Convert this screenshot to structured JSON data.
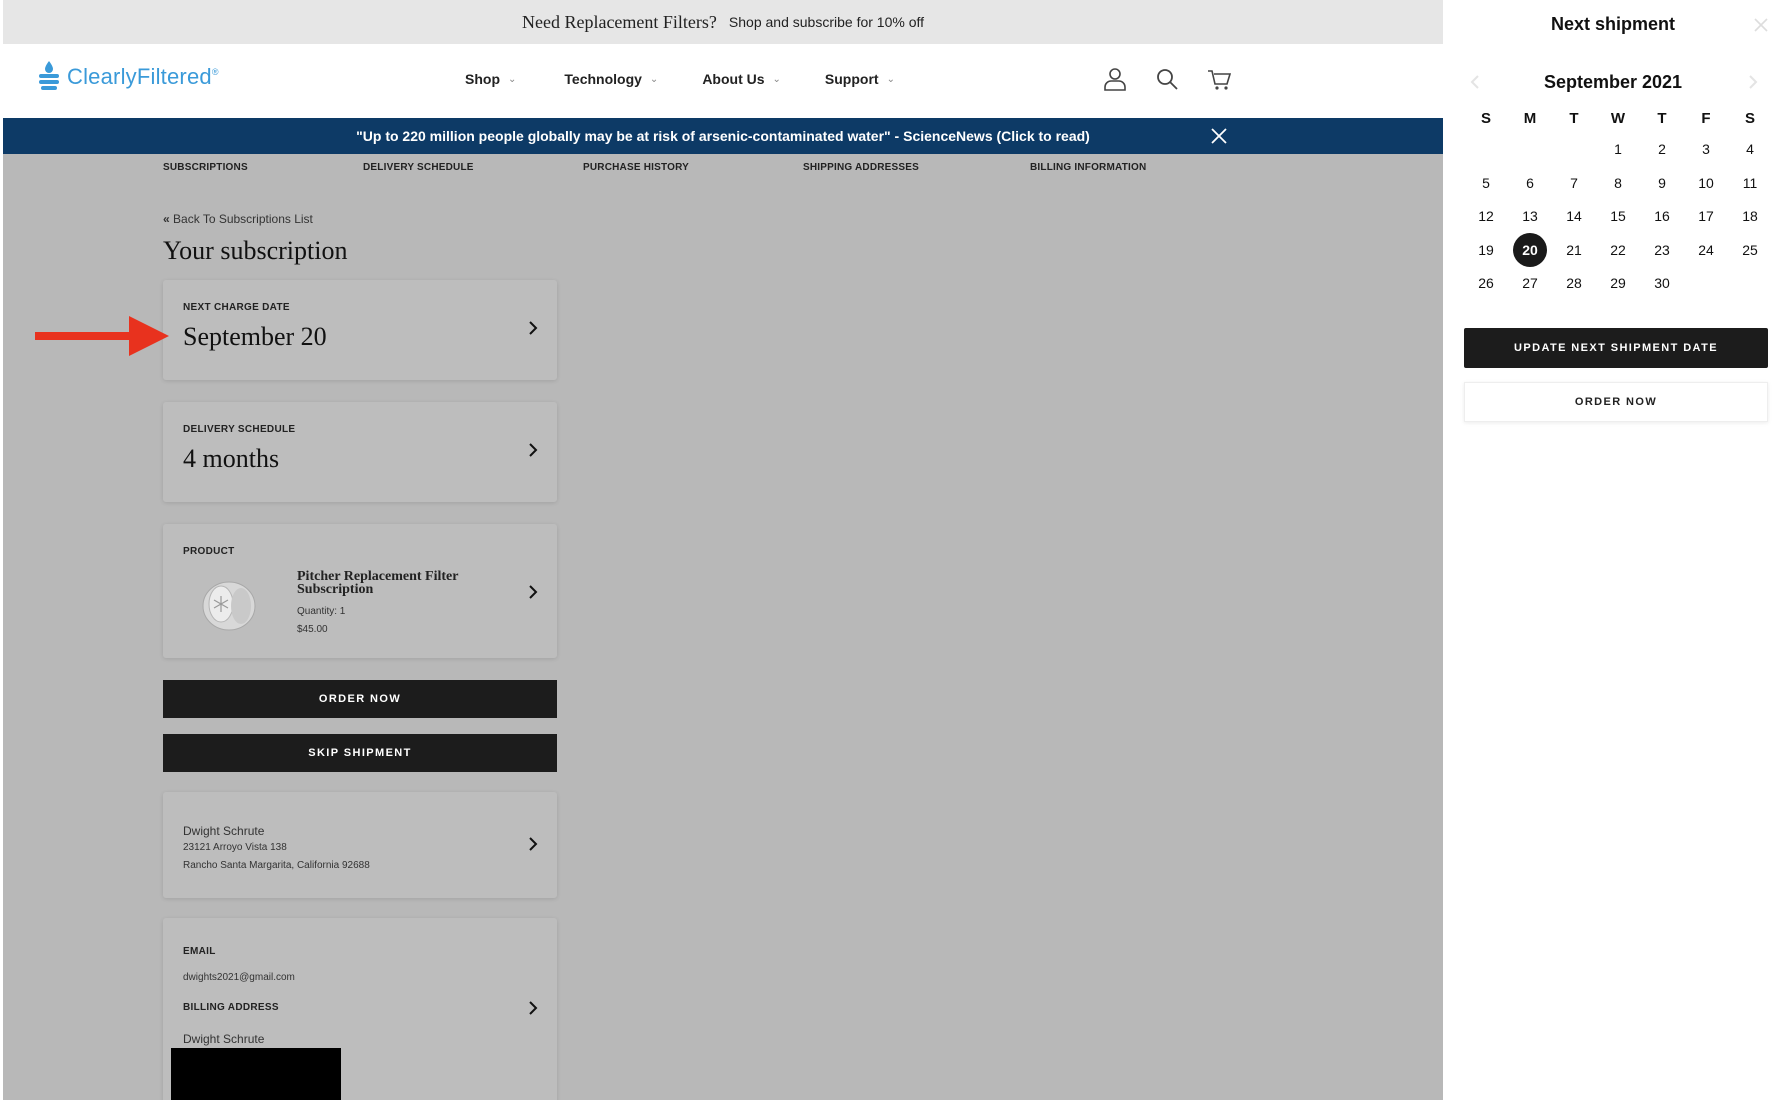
{
  "promo": {
    "headline": "Need Replacement Filters?",
    "offer": "Shop and subscribe for 10% off"
  },
  "header": {
    "brand": "ClearlyFiltered",
    "brand_mark": "®",
    "nav": [
      {
        "label": "Shop"
      },
      {
        "label": "Technology"
      },
      {
        "label": "About Us"
      },
      {
        "label": "Support"
      }
    ],
    "icons": [
      "account-icon",
      "search-icon",
      "cart-icon"
    ]
  },
  "alert": {
    "text": "\"Up to 220 million people globally may be at risk of arsenic-contaminated water\" - ScienceNews (Click to read)"
  },
  "account_nav": [
    "SUBSCRIPTIONS",
    "DELIVERY SCHEDULE",
    "PURCHASE HISTORY",
    "SHIPPING ADDRESSES",
    "BILLING INFORMATION"
  ],
  "subscription": {
    "back_link": "Back To Subscriptions List",
    "title": "Your subscription",
    "next_charge": {
      "label": "NEXT CHARGE DATE",
      "value": "September 20"
    },
    "delivery": {
      "label": "DELIVERY SCHEDULE",
      "value": "4 months"
    },
    "product": {
      "label": "PRODUCT",
      "name": "Pitcher Replacement Filter Subscription",
      "quantity": "Quantity: 1",
      "price": "$45.00"
    },
    "order_now": "ORDER NOW",
    "skip_shipment": "SKIP SHIPMENT",
    "shipping": {
      "name": "Dwight Schrute",
      "line1": "23121 Arroyo Vista 138",
      "line2": "Rancho Santa Margarita, California 92688"
    },
    "billing": {
      "email_label": "EMAIL",
      "email": "dwights2021@gmail.com",
      "address_label": "BILLING ADDRESS",
      "name": "Dwight Schrute"
    }
  },
  "panel": {
    "title": "Next shipment",
    "month": "September 2021",
    "weekdays": [
      "S",
      "M",
      "T",
      "W",
      "T",
      "F",
      "S"
    ],
    "first_weekday_index": 3,
    "days_in_month": 30,
    "selected_day": 20,
    "update_button": "UPDATE NEXT SHIPMENT DATE",
    "order_button": "ORDER NOW"
  },
  "colors": {
    "accent_blue": "#3a9ad9",
    "alert_bg": "#0d3a66",
    "arrow": "#e8321e",
    "dark_button": "#1c1c1c"
  }
}
